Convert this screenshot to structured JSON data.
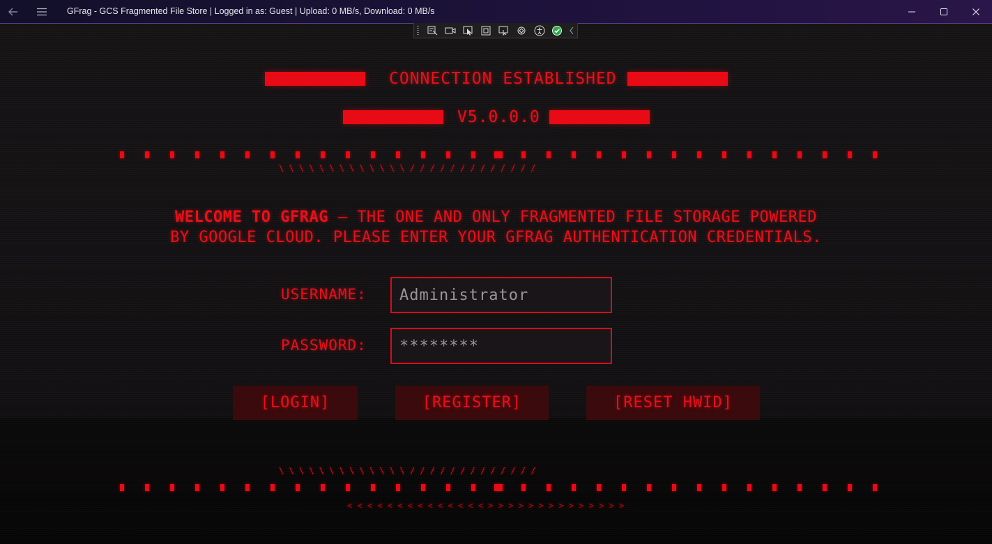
{
  "window": {
    "title": "GFrag - GCS Fragmented File Store | Logged in as: Guest | Upload: 0 MB/s, Download: 0 MB/s"
  },
  "icons": {
    "back": "back-arrow-icon",
    "menu": "hamburger-menu-icon",
    "minimize": "minimize-icon",
    "maximize": "maximize-icon",
    "close": "close-icon"
  },
  "devbar_icons": [
    "select-element-icon",
    "video-icon",
    "pointer-select-icon",
    "frame-icon",
    "tracking-icon",
    "hot-reload-icon",
    "accessibility-icon",
    "check-status-icon",
    "collapse-chevron-icon"
  ],
  "header": {
    "status": "CONNECTION ESTABLISHED",
    "version": "V5.0.0.0"
  },
  "decor": {
    "slashes_top": "\\ \\ \\ \\ \\ \\ \\ \\ \\ \\ \\ \\ \\   / / / / / / / / / / / / /",
    "slashes_bottom": "\\ \\ \\ \\ \\ \\ \\ \\ \\ \\ \\ \\ \\   / / / / / / / / / / / / /",
    "arrows_bottom": "< < < < < < < < < < < < < <    > > > > > > > > > > > > > >"
  },
  "welcome": {
    "strong": "WELCOME TO GFRAG",
    "rest_line1": " — THE ONE AND ONLY FRAGMENTED FILE STORAGE POWERED",
    "line2": "BY GOOGLE CLOUD. PLEASE ENTER YOUR GFRAG AUTHENTICATION CREDENTIALS."
  },
  "form": {
    "username_label": "USERNAME:",
    "username_value": "Administrator",
    "password_label": "PASSWORD:",
    "password_value": "********"
  },
  "buttons": {
    "login": "[LOGIN]",
    "register": "[REGISTER]",
    "reset": "[RESET HWID]"
  },
  "colors": {
    "accent": "#e80a14",
    "background": "#121012",
    "button_bg": "#3a0a0c"
  }
}
